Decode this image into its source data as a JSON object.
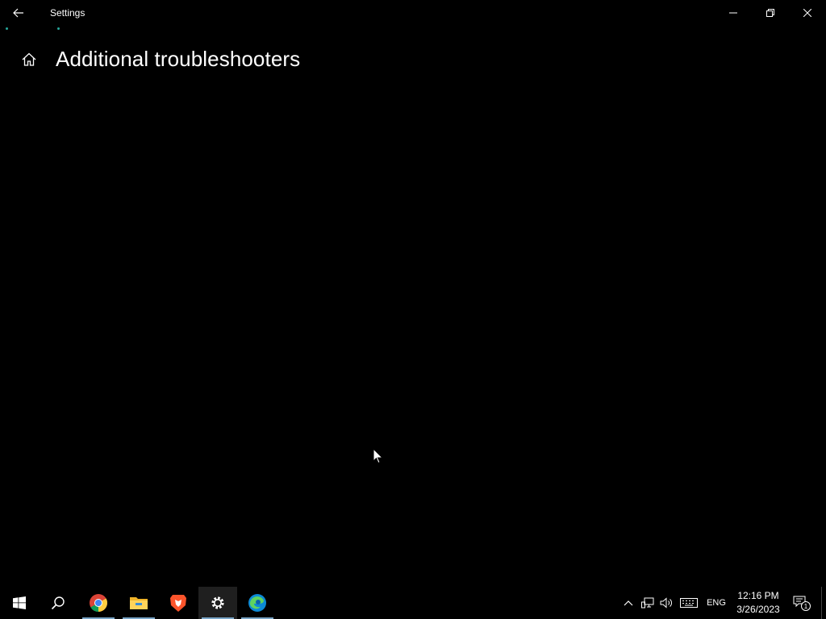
{
  "window": {
    "title": "Settings",
    "controls": {
      "minimize": "minimize",
      "maximize": "restore",
      "close": "close"
    }
  },
  "page": {
    "title": "Additional troubleshooters"
  },
  "taskbar": {
    "apps": [
      {
        "name": "start-icon",
        "active": false
      },
      {
        "name": "search-icon",
        "active": false
      },
      {
        "name": "chrome-icon",
        "active": false,
        "running": true
      },
      {
        "name": "file-explorer-icon",
        "active": false,
        "running": true
      },
      {
        "name": "brave-icon",
        "active": false
      },
      {
        "name": "settings-icon",
        "active": true,
        "running": true
      },
      {
        "name": "edge-icon",
        "active": false,
        "running": true
      }
    ],
    "tray": {
      "language": "ENG",
      "time": "12:16 PM",
      "date": "3/26/2023",
      "notification_count": "1"
    }
  },
  "colors": {
    "background": "#000000",
    "accent_loading": "#26a69a",
    "active_taskbar": "#1f1f1f",
    "running_underline": "#7aa6c8"
  }
}
